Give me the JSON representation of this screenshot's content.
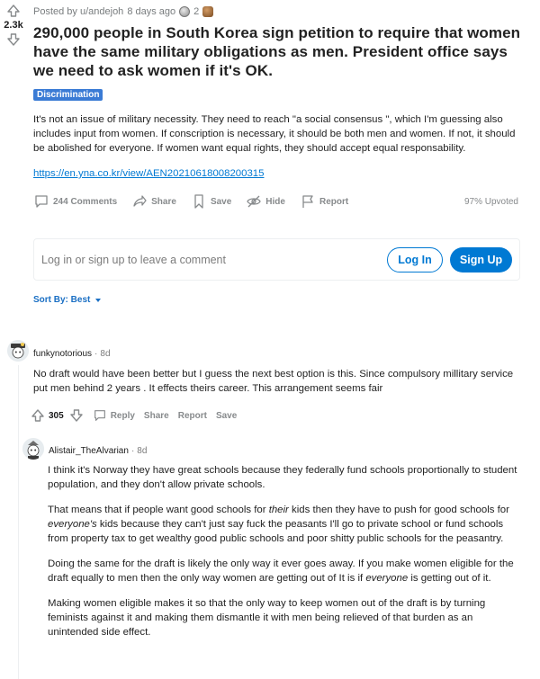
{
  "post": {
    "score": "2.3k",
    "posted_by": "Posted by u/andejoh",
    "age": "8 days ago",
    "award_count": "2",
    "title": "290,000 people in South Korea sign petition to require that women have the same military obligations as men. President office says we need to ask women if it's OK.",
    "flair": "Discrimination",
    "body": "It's not an issue of military necessity. They need to reach \"a social consensus \", which I'm guessing also includes input from women. If conscription is necessary, it should be both men and women. If not, it should be abolished for everyone. If women want equal rights, they should accept equal responsability.",
    "link": "https://en.yna.co.kr/view/AEN20210618008200315",
    "comments_label": "244 Comments",
    "share_label": "Share",
    "save_label": "Save",
    "hide_label": "Hide",
    "report_label": "Report",
    "upvoted": "97% Upvoted"
  },
  "comment_box": {
    "prompt": "Log in or sign up to leave a comment",
    "login": "Log In",
    "signup": "Sign Up"
  },
  "sort": {
    "label": "Sort By: Best"
  },
  "comments": [
    {
      "author": "funkynotorious",
      "age": "8d",
      "paragraphs": [
        "No draft would have been better but I guess the next best option is this. Since compulsory millitary service put men behind 2 years . It effects theirs career. This arrangement seems fair"
      ],
      "score": "305",
      "reply": "Reply",
      "share": "Share",
      "report": "Report",
      "save": "Save"
    },
    {
      "author": "Alistair_TheAlvarian",
      "age": "8d",
      "p1": "I think it's Norway they have great schools because they federally fund schools proportionally to student population, and they don't allow private schools.",
      "p2_a": "That means that if people want good schools for ",
      "p2_em1": "their",
      "p2_b": " kids then they have to push for good schools for ",
      "p2_em2": "everyone's",
      "p2_c": " kids because they can't just say fuck the peasants I'll go to private school or fund schools from property tax to get wealthy good public schools and poor shitty public schools for the peasantry.",
      "p3_a": "Doing the same for the draft is likely the only way it ever goes away. If you make women eligible for the draft equally to men then the only way women are getting out of It is if ",
      "p3_em": "everyone",
      "p3_b": " is getting out of it.",
      "p4": "Making women eligible makes it so that the only way to keep women out of the draft is by turning feminists against it and making them dismantle it with men being relieved of that burden as an unintended side effect."
    }
  ]
}
